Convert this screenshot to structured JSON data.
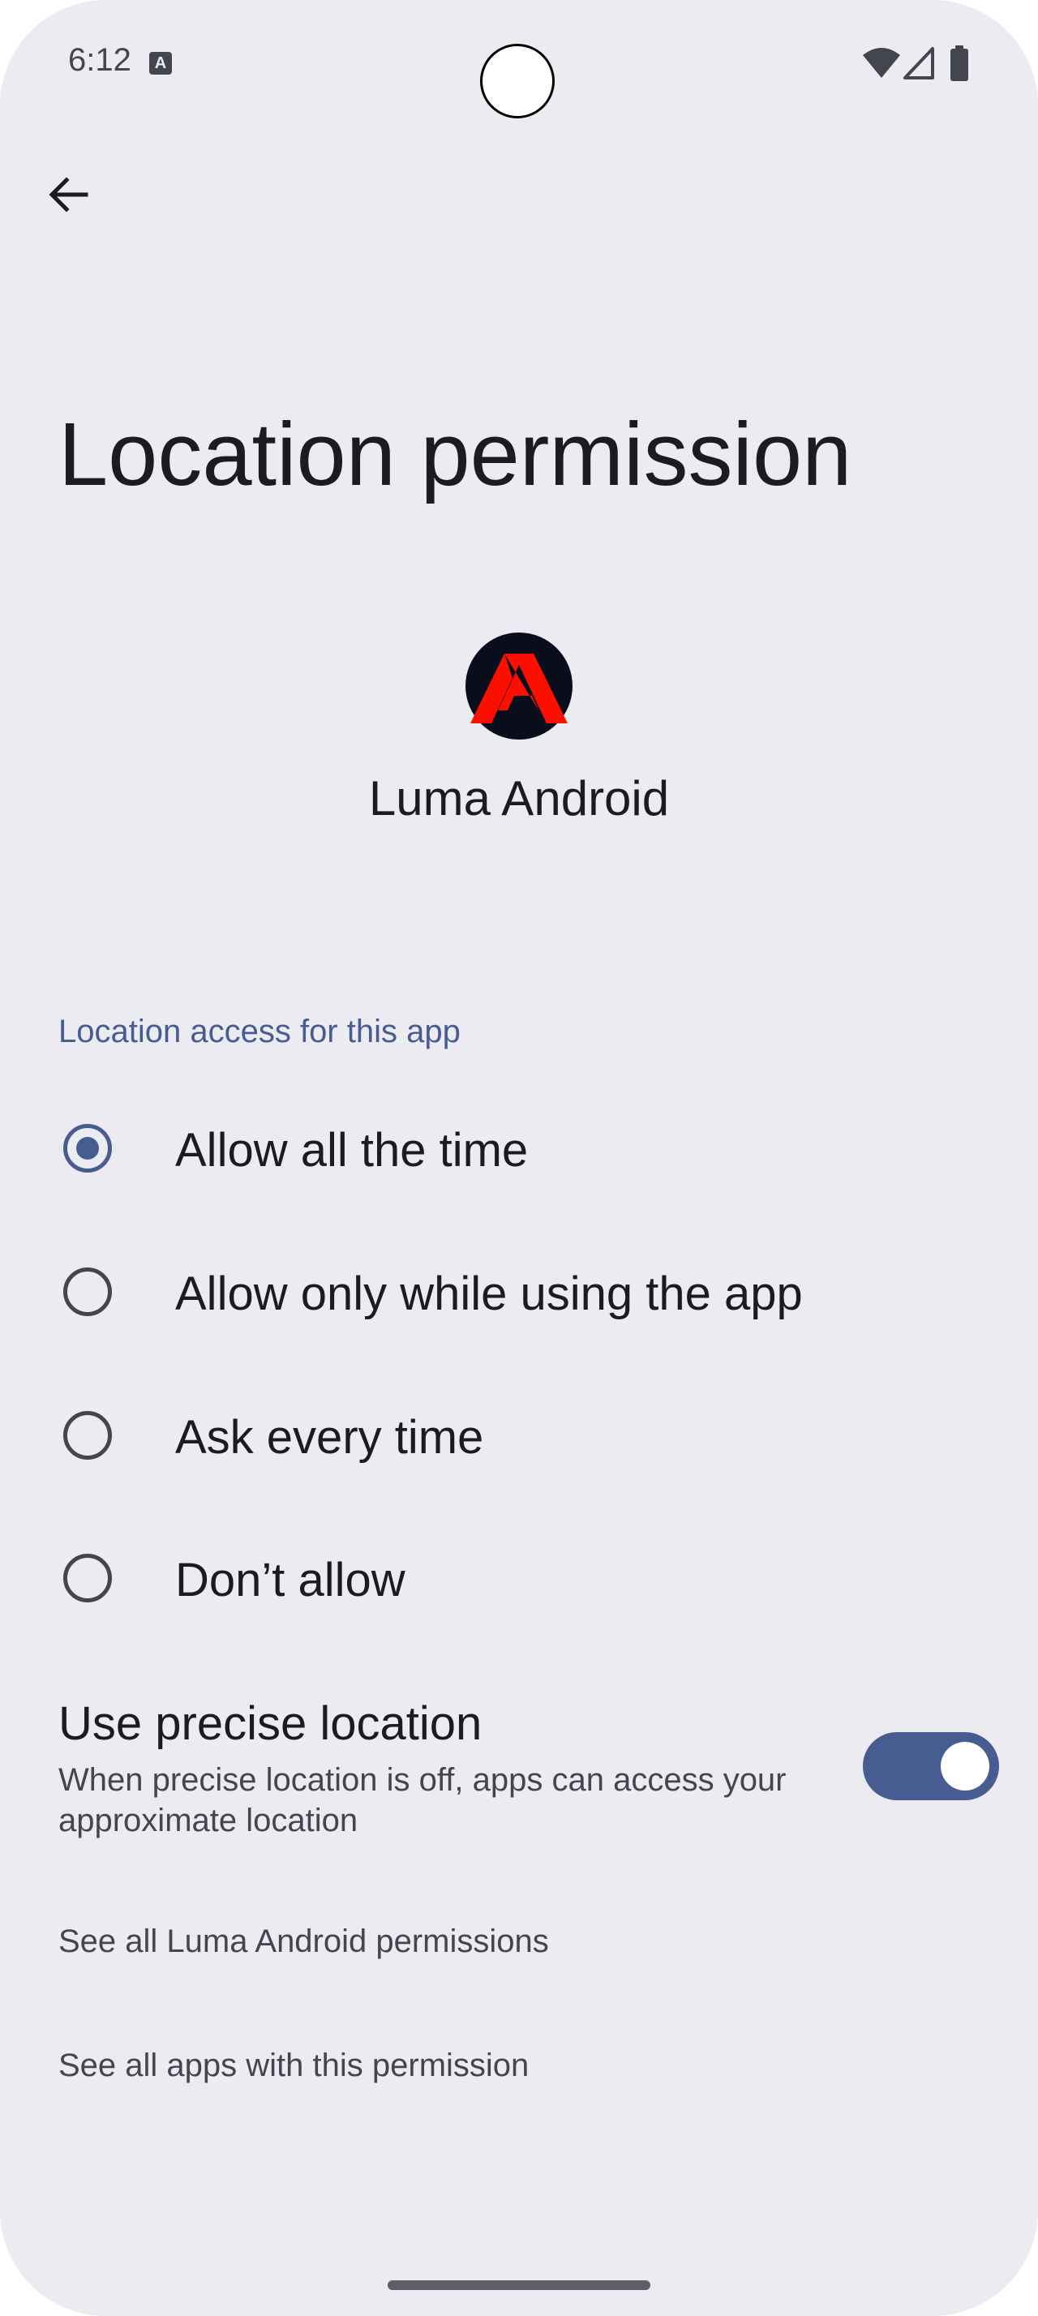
{
  "status_bar": {
    "time": "6:12",
    "notification_icon": "text-a-icon",
    "icons": [
      "wifi-icon",
      "cellular-signal-icon",
      "battery-icon"
    ]
  },
  "nav": {
    "back_icon": "arrow-left-icon"
  },
  "header": {
    "title": "Location permission"
  },
  "app": {
    "name": "Luma Android",
    "icon": "adobe-logo-icon"
  },
  "location_access": {
    "section_label": "Location access for this app",
    "options": [
      {
        "label": "Allow all the time",
        "selected": true
      },
      {
        "label": "Allow only while using the app",
        "selected": false
      },
      {
        "label": "Ask every time",
        "selected": false
      },
      {
        "label": "Don’t allow",
        "selected": false
      }
    ]
  },
  "precise_location": {
    "title": "Use precise location",
    "description": "When precise location is off, apps can access your approximate location",
    "enabled": true
  },
  "links": {
    "app_permissions": "See all Luma Android permissions",
    "apps_with_permission": "See all apps with this permission"
  },
  "colors": {
    "background": "#ecebf2",
    "accent": "#475d92",
    "text_primary": "#1b1b21",
    "text_secondary": "#44464f",
    "app_icon_red": "#fa0f00"
  }
}
